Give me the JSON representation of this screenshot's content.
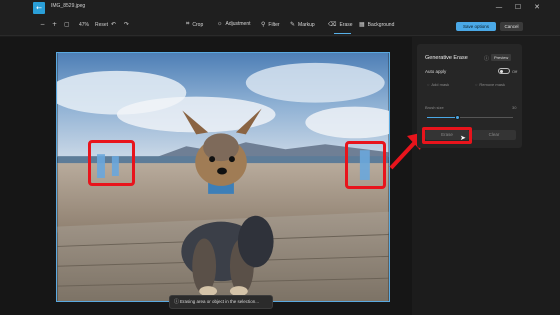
{
  "titlebar": {
    "filename": "IMG_8529.jpeg",
    "app_icon": "back-arrow-icon",
    "controls": [
      "—",
      "☐",
      "✕"
    ]
  },
  "toolbar": {
    "zoom_out": "−",
    "zoom_in": "+",
    "zoom": "47%",
    "reset": "Reset",
    "undo": "↶",
    "redo": "↷",
    "tools": [
      {
        "label": "Crop",
        "icon": "crop-icon",
        "glyph": "⌗"
      },
      {
        "label": "Adjustment",
        "icon": "adjustment-icon",
        "glyph": "☼"
      },
      {
        "label": "Filter",
        "icon": "filter-icon",
        "glyph": "⚲"
      },
      {
        "label": "Markup",
        "icon": "markup-icon",
        "glyph": "✎"
      },
      {
        "label": "Erase",
        "icon": "erase-icon",
        "glyph": "⌫"
      },
      {
        "label": "Background",
        "icon": "background-icon",
        "glyph": "▦"
      }
    ],
    "active_tool": "Erase",
    "save_label": "Save options",
    "cancel_label": "Cancel"
  },
  "panel": {
    "title": "Generative Erase",
    "badge": "Preview",
    "auto_apply_label": "Auto apply",
    "auto_apply_state": "Off",
    "add_mask": "Add mask",
    "remove_mask": "Remove mask",
    "brush_label": "Brush size",
    "brush_value": "30",
    "brush_fraction": 0.35,
    "erase_label": "Erase",
    "clear_label": "Clear"
  },
  "toast": {
    "text": "Erasing area or object in the selection..."
  },
  "colors": {
    "accent": "#4aa8e6",
    "highlight_red": "#e8141c",
    "bg": "#1c1c1c"
  }
}
